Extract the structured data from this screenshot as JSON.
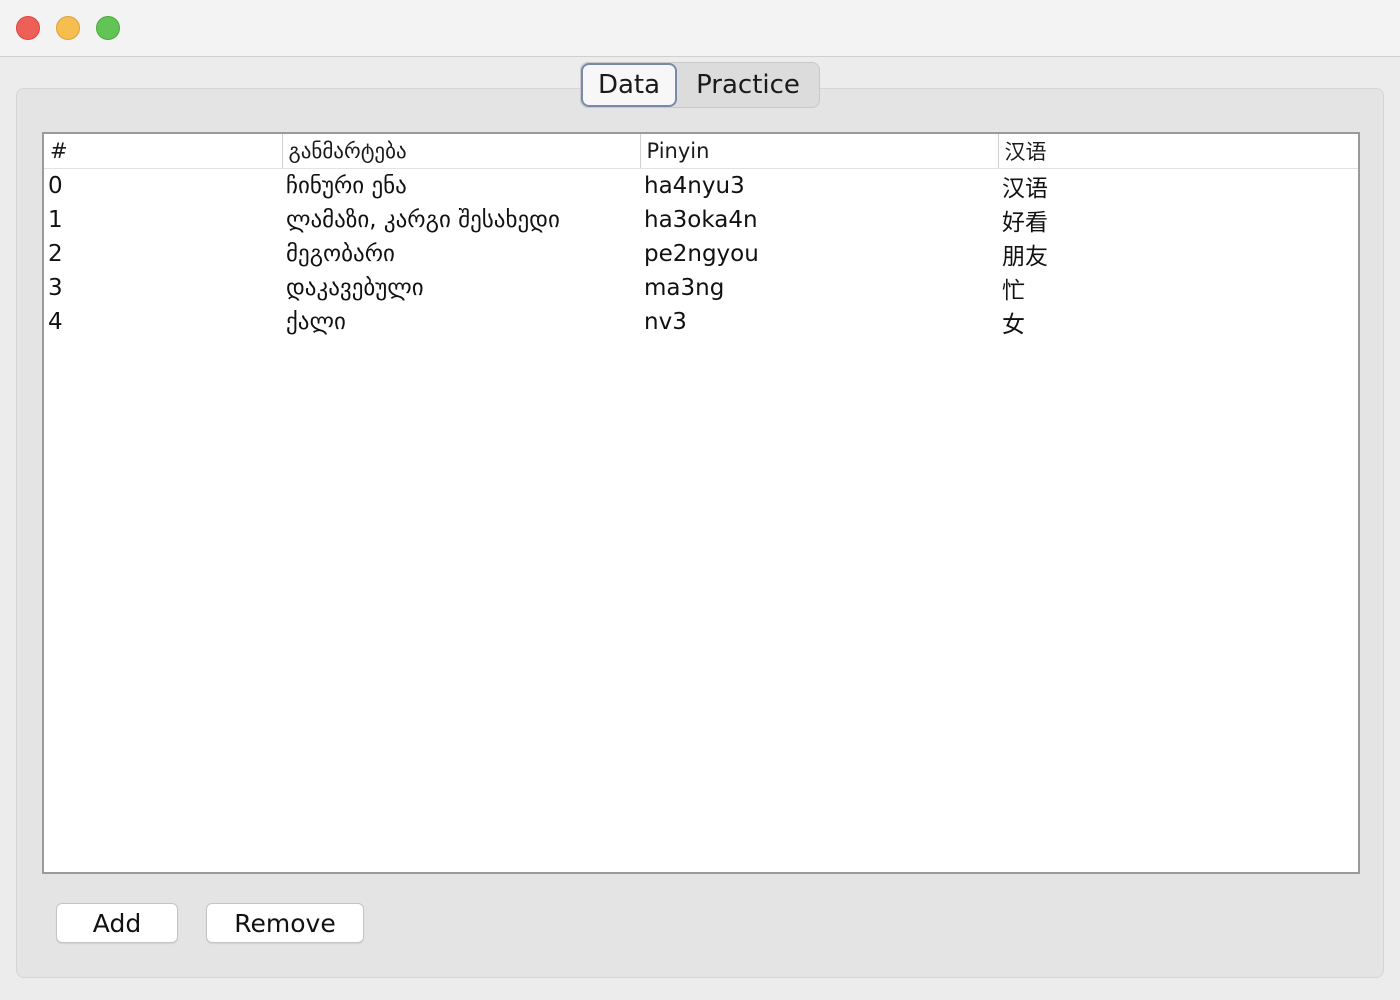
{
  "window": {
    "controls": {
      "close": "close-icon",
      "minimize": "minimize-icon",
      "zoom": "zoom-icon"
    }
  },
  "tabs": [
    {
      "label": "Data",
      "selected": true
    },
    {
      "label": "Practice",
      "selected": false
    }
  ],
  "table": {
    "columns": [
      "#",
      "განმარტება",
      "Pinyin",
      "汉语"
    ],
    "rows": [
      [
        "0",
        "ჩინური ენა",
        "ha4nyu3",
        "汉语"
      ],
      [
        "1",
        "ლამაზი, კარგი შესახედი",
        "ha3oka4n",
        "好看"
      ],
      [
        "2",
        "მეგობარი",
        "pe2ngyou",
        "朋友"
      ],
      [
        "3",
        "დაკავებული",
        "ma3ng",
        "忙"
      ],
      [
        "4",
        "ქალი",
        "nv3",
        "女"
      ]
    ]
  },
  "buttons": {
    "add": "Add",
    "remove": "Remove"
  },
  "colors": {
    "close": "#ee5f57",
    "minimize": "#f6bd4f",
    "zoom": "#61c454",
    "selected_tab_border": "#7a8aa8"
  }
}
